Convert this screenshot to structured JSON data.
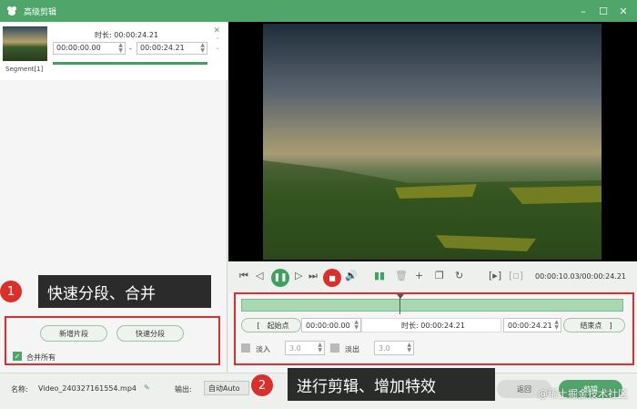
{
  "window": {
    "title": "高级剪辑"
  },
  "segment": {
    "label": "Segment[1]",
    "duration_label": "时长:",
    "duration": "00:00:24.21",
    "start_time": "00:00:00.00",
    "end_time": "00:00:24.21"
  },
  "callouts": [
    {
      "num": "1",
      "text": "快速分段、合并"
    },
    {
      "num": "2",
      "text": "进行剪辑、增加特效"
    }
  ],
  "left_actions": {
    "new_segment": "新增片段",
    "quick_split": "快速分段",
    "merge_all": "合并所有"
  },
  "bottom": {
    "name_label": "名称:",
    "filename": "Video_240327161554.mp4",
    "output_label": "输出:",
    "output_value": "自动Auto",
    "back_button": "返回",
    "edit_button": "剪辑"
  },
  "player": {
    "timecode": "00:00:10.03/00:00:24.21"
  },
  "editor": {
    "start_btn": "起始点",
    "start_time": "00:00:00.00",
    "duration_label": "时长:",
    "duration": "00:00:24.21",
    "end_time": "00:00:24.21",
    "end_btn": "结束点",
    "fade_in_label": "淡入",
    "fade_in_value": "3.0",
    "fade_out_label": "淡出",
    "fade_out_value": "3.0",
    "playhead_fraction": 0.414
  },
  "watermark": "@稀土掘金技术社区",
  "colors": {
    "accent": "#4fa56a",
    "callout_red": "#d9302c"
  }
}
